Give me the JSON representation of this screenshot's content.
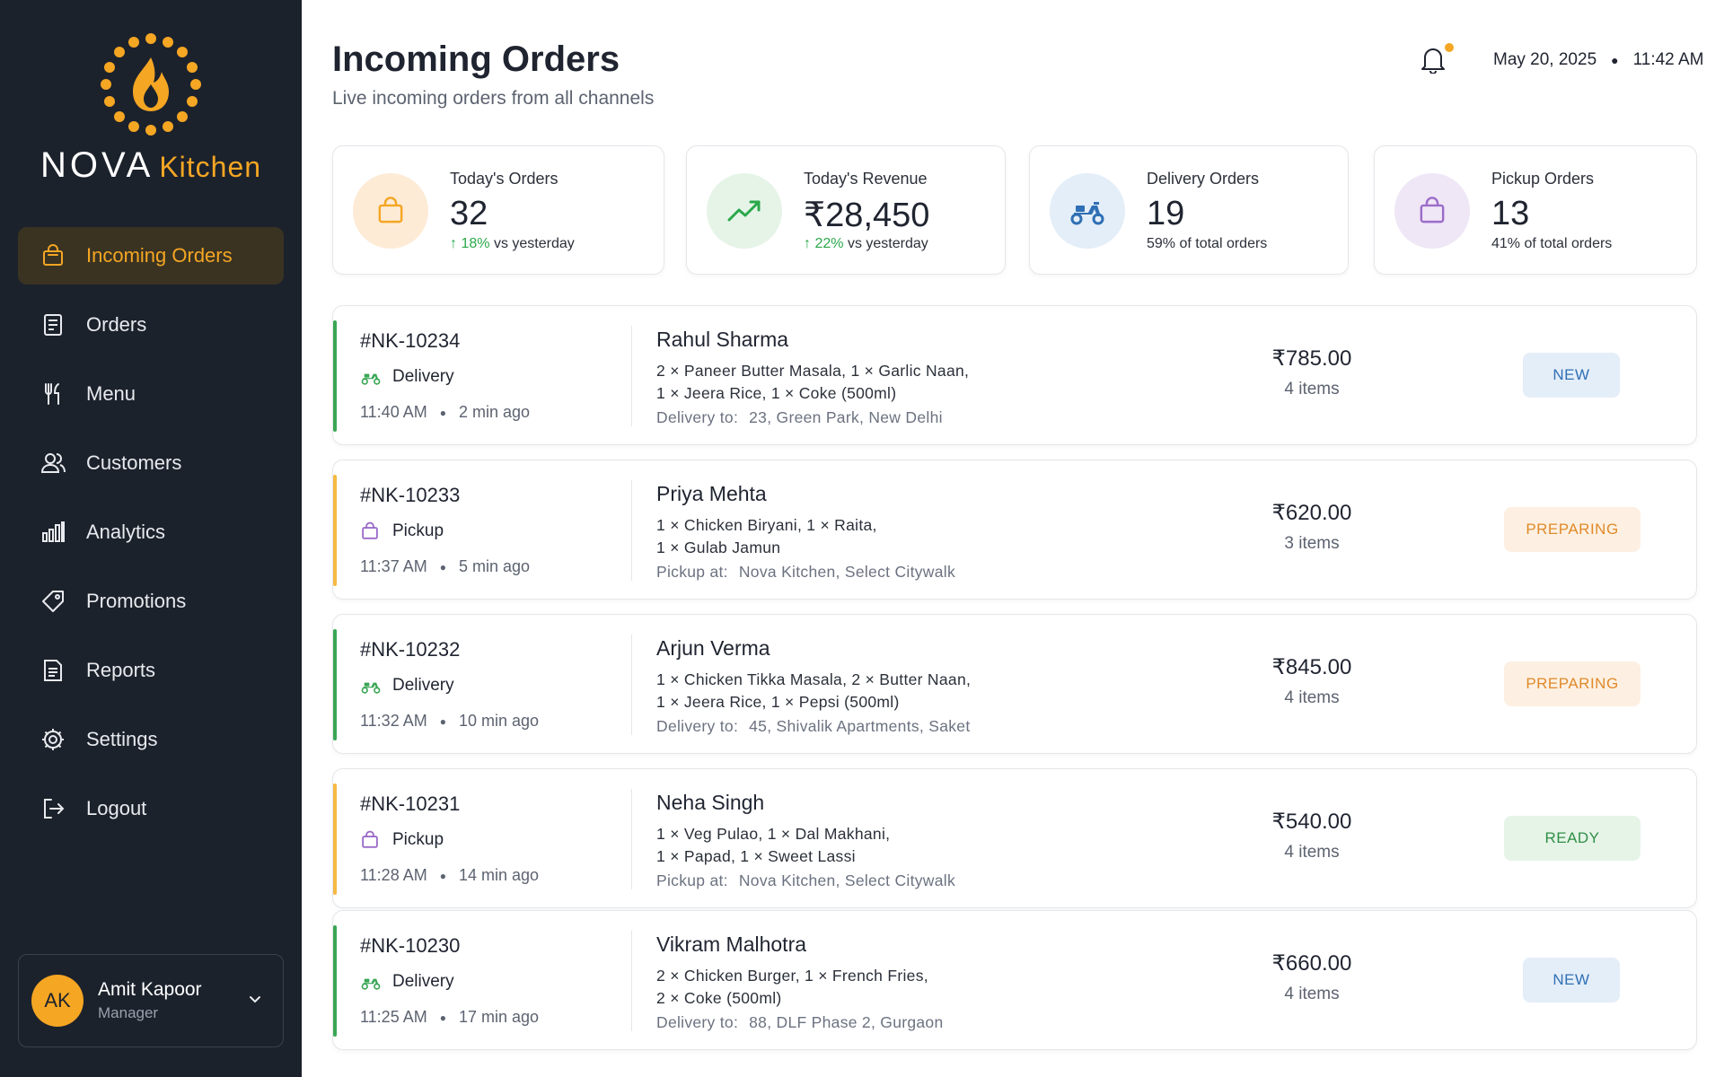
{
  "brand": {
    "name": "NOVA",
    "suffix": "Kitchen",
    "accent": "#f5a623"
  },
  "sidebar": {
    "items": [
      {
        "label": "Incoming Orders",
        "icon": "shopping-bag-icon",
        "active": true
      },
      {
        "label": "Orders",
        "icon": "receipt-icon",
        "active": false
      },
      {
        "label": "Menu",
        "icon": "fork-knife-icon",
        "active": false
      },
      {
        "label": "Customers",
        "icon": "users-icon",
        "active": false
      },
      {
        "label": "Analytics",
        "icon": "bar-chart-icon",
        "active": false
      },
      {
        "label": "Promotions",
        "icon": "tag-icon",
        "active": false
      },
      {
        "label": "Reports",
        "icon": "report-icon",
        "active": false
      },
      {
        "label": "Settings",
        "icon": "gear-icon",
        "active": false
      },
      {
        "label": "Logout",
        "icon": "logout-icon",
        "active": false
      }
    ],
    "user": {
      "initials": "AK",
      "name": "Amit Kapoor",
      "role": "Manager"
    }
  },
  "header": {
    "title": "Incoming Orders",
    "subtitle": "Live incoming orders from all channels",
    "date": "May 20, 2025",
    "time": "11:42 AM"
  },
  "stats": [
    {
      "label": "Today's Orders",
      "value": "32",
      "delta": "18%",
      "delta_suffix": "vs yesterday",
      "icon": "shopping-bag-icon",
      "color": "#f5a623"
    },
    {
      "label": "Today's Revenue",
      "value": "₹28,450",
      "delta": "22%",
      "delta_suffix": "vs yesterday",
      "icon": "trend-up-icon",
      "color": "#2aa84a"
    },
    {
      "label": "Delivery Orders",
      "value": "19",
      "note": "59% of total orders",
      "icon": "scooter-icon",
      "color": "#2f6fb5"
    },
    {
      "label": "Pickup Orders",
      "value": "13",
      "note": "41% of total orders",
      "icon": "shopping-bag-icon",
      "color": "#9b6cc9"
    }
  ],
  "orders": [
    {
      "id": "#NK-10234",
      "type": "Delivery",
      "time": "11:40 AM",
      "ago": "2 min ago",
      "customer": "Rahul Sharma",
      "items_line1": "2 × Paneer Butter Masala, 1 × Garlic Naan,",
      "items_line2": "1 × Jeera Rice, 1 × Coke (500ml)",
      "addr_label": "Delivery to:",
      "addr": "23, Green Park, New Delhi",
      "price": "₹785.00",
      "count": "4 items",
      "status": "NEW"
    },
    {
      "id": "#NK-10233",
      "type": "Pickup",
      "time": "11:37 AM",
      "ago": "5 min ago",
      "customer": "Priya Mehta",
      "items_line1": "1 × Chicken Biryani, 1 × Raita,",
      "items_line2": "1 × Gulab Jamun",
      "addr_label": "Pickup at:",
      "addr": "Nova Kitchen, Select Citywalk",
      "price": "₹620.00",
      "count": "3 items",
      "status": "PREPARING"
    },
    {
      "id": "#NK-10232",
      "type": "Delivery",
      "time": "11:32 AM",
      "ago": "10 min ago",
      "customer": "Arjun Verma",
      "items_line1": "1 × Chicken Tikka Masala, 2 × Butter Naan,",
      "items_line2": "1 × Jeera Rice, 1 × Pepsi (500ml)",
      "addr_label": "Delivery to:",
      "addr": "45, Shivalik Apartments, Saket",
      "price": "₹845.00",
      "count": "4 items",
      "status": "PREPARING"
    },
    {
      "id": "#NK-10231",
      "type": "Pickup",
      "time": "11:28 AM",
      "ago": "14 min ago",
      "customer": "Neha Singh",
      "items_line1": "1 × Veg Pulao, 1 × Dal Makhani,",
      "items_line2": "1 × Papad, 1 × Sweet Lassi",
      "addr_label": "Pickup at:",
      "addr": "Nova Kitchen, Select Citywalk",
      "price": "₹540.00",
      "count": "4 items",
      "status": "READY"
    },
    {
      "id": "#NK-10230",
      "type": "Delivery",
      "time": "11:25 AM",
      "ago": "17 min ago",
      "customer": "Vikram Malhotra",
      "items_line1": "2 × Chicken Burger, 1 × French Fries,",
      "items_line2": "2 × Coke (500ml)",
      "addr_label": "Delivery to:",
      "addr": "88, DLF Phase 2, Gurgaon",
      "price": "₹660.00",
      "count": "4 items",
      "status": "NEW"
    }
  ],
  "colors": {
    "delivery": "#3aa655",
    "pickup": "#f5b942",
    "sidebar_bg": "#1c222c"
  }
}
